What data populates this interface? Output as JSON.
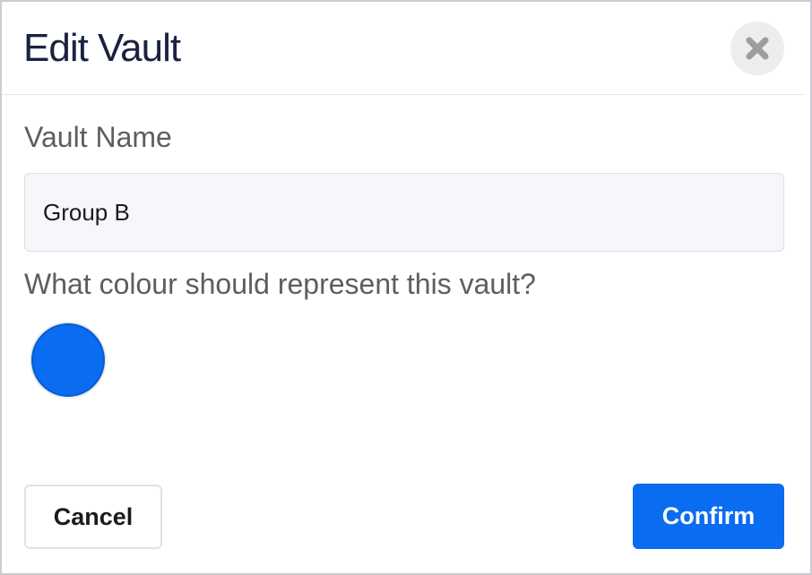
{
  "modal": {
    "title": "Edit Vault",
    "close_icon": "close-icon"
  },
  "form": {
    "name_label": "Vault Name",
    "name_value": "Group B",
    "colour_label": "What colour should represent this vault?",
    "selected_colour": "#0a6cf0"
  },
  "actions": {
    "cancel_label": "Cancel",
    "confirm_label": "Confirm"
  },
  "colors": {
    "accent": "#0a6cf0",
    "accent_text": "#ffffff"
  }
}
